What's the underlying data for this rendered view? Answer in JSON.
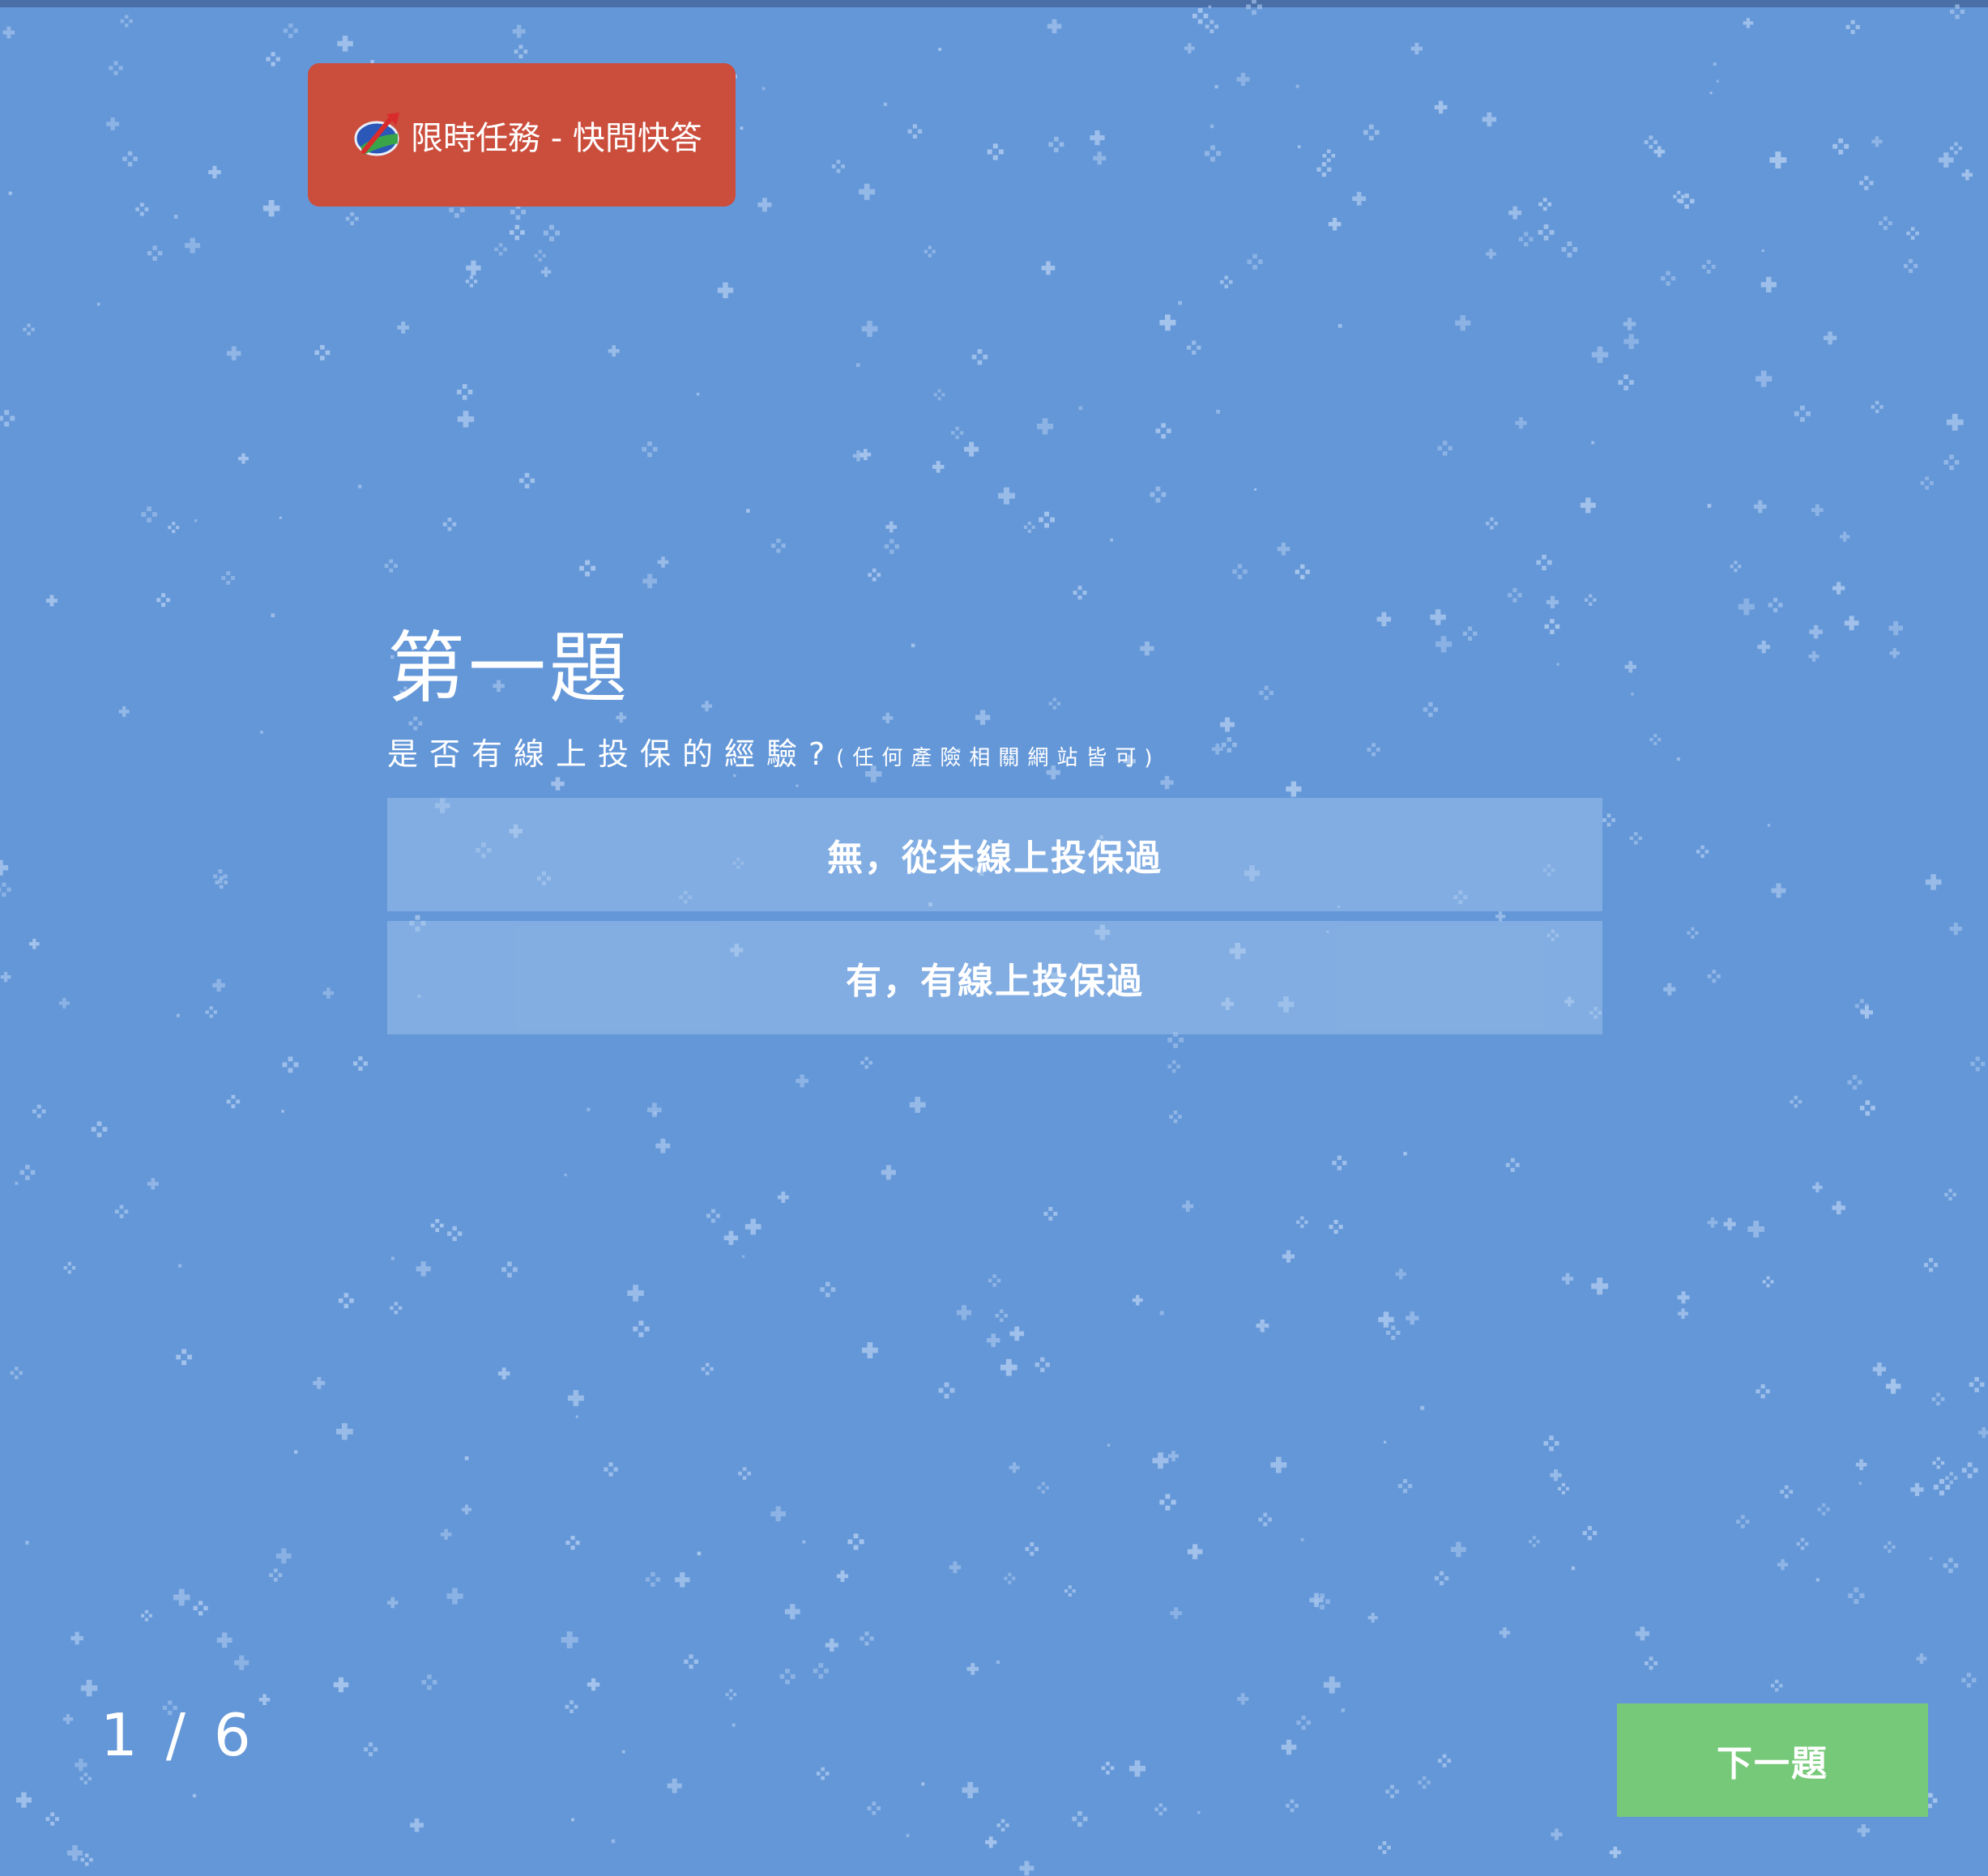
{
  "header": {
    "logo_icon": "globe-arrow-logo",
    "title": "限時任務 - 快問快答"
  },
  "question": {
    "number": "第一題",
    "text": "是否有線上投保的經驗?",
    "note": "(任何產險相關網站皆可)"
  },
  "options": [
    {
      "label": "無，從未線上投保過"
    },
    {
      "label": "有，有線上投保過"
    }
  ],
  "progress": {
    "current": 1,
    "total": 6,
    "label": "1 / 6"
  },
  "next_button": {
    "label": "下一題"
  },
  "colors": {
    "background": "#6497d8",
    "badge": "#cb4e3d",
    "next_button": "#76c979",
    "option": "#8ab4e6"
  }
}
